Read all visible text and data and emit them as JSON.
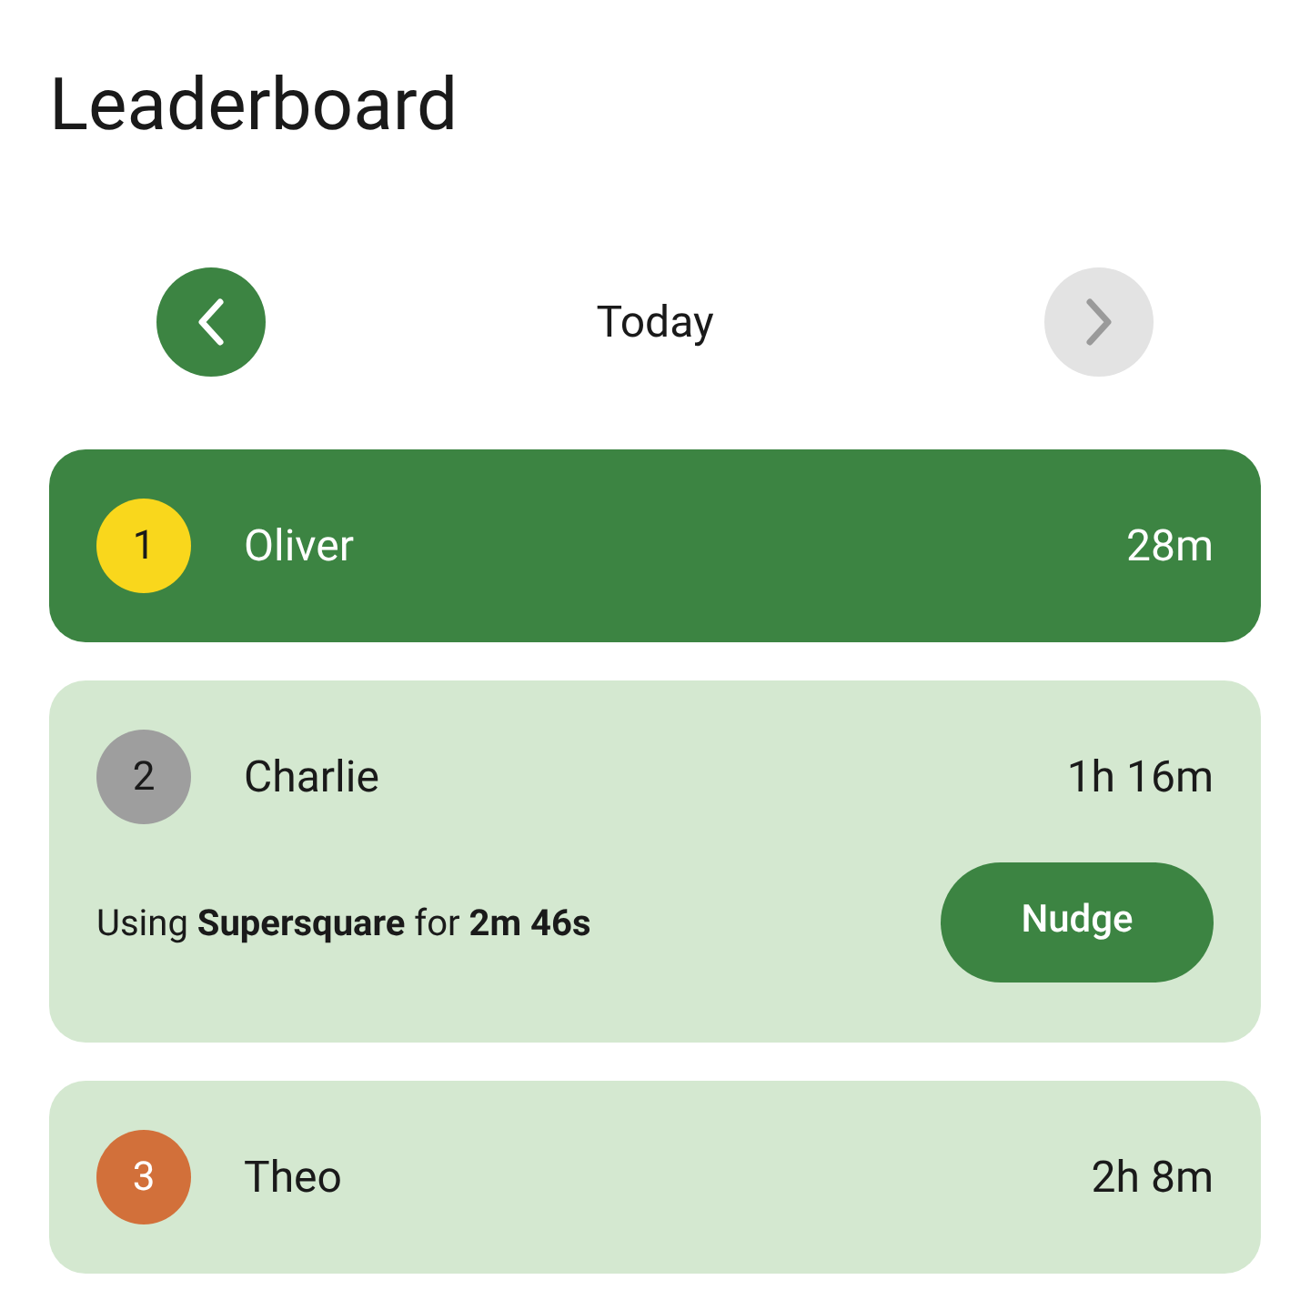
{
  "title": "Leaderboard",
  "nav": {
    "label": "Today",
    "prev": {
      "disabled": false
    },
    "next": {
      "disabled": true
    }
  },
  "entries": [
    {
      "rank": "1",
      "name": "Oliver",
      "time": "28m",
      "color": "#f9d71c",
      "selected": true
    },
    {
      "rank": "2",
      "name": "Charlie",
      "time": "1h 16m",
      "color": "#9e9e9e",
      "selected": false,
      "activity": "Using **Supersquare** for **2m 46s**",
      "action": "Nudge"
    },
    {
      "rank": "3",
      "name": "Theo",
      "time": "2h 8m",
      "color": "#d2703a",
      "selected": false
    }
  ]
}
